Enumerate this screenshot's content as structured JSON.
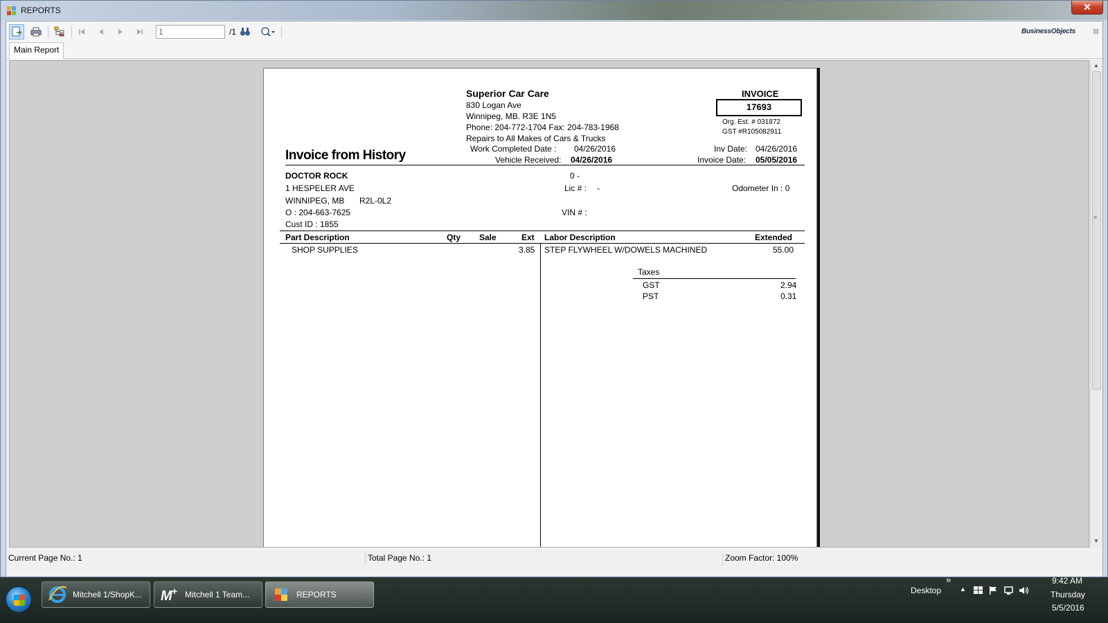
{
  "window": {
    "title": "REPORTS",
    "close_glyph": "✕"
  },
  "toolbar": {
    "page_value": "1",
    "page_total": "/1",
    "logo_main": "Business",
    "logo_accent": "Objects",
    "logo_close": "⊠"
  },
  "tabs": [
    {
      "label": "Main Report"
    }
  ],
  "report": {
    "company": {
      "name": "Superior Car Care",
      "address1": "830 Logan Ave",
      "address2": "Winnipeg, MB.  R3E 1N5",
      "phone": "Phone: 204-772-1704   Fax: 204-783-1968",
      "tagline": "Repairs to All Makes of Cars & Trucks"
    },
    "invoice_label": "INVOICE",
    "invoice_number": "17693",
    "org_est": "Org. Est. # 031872",
    "gst_reg": "GST #R105082911",
    "title": "Invoice from History",
    "work_completed_label": "Work Completed Date :",
    "work_completed_value": "04/26/2016",
    "vehicle_received_label": "Vehicle Received:",
    "vehicle_received_value": "04/26/2016",
    "inv_date_label": "Inv Date:",
    "inv_date_value": "04/26/2016",
    "invoice_date_label": "Invoice Date:",
    "invoice_date_value": "05/05/2016",
    "customer": {
      "name": "DOCTOR ROCK",
      "address1": "1 HESPELER AVE",
      "city": "WINNIPEG, MB",
      "postal": "R2L-0L2",
      "phone": "O :  204-663-7625",
      "cust_id": "Cust ID :  1855"
    },
    "vehicle": {
      "line1": "0  -",
      "lic_label": "Lic # :",
      "lic_value": "-",
      "vin_label": "VIN # :",
      "odometer": "Odometer In :  0"
    },
    "parts_headers": {
      "desc": "Part Description",
      "qty": "Qty",
      "sale": "Sale",
      "ext": "Ext"
    },
    "labor_headers": {
      "desc": "Labor Description",
      "ext": "Extended"
    },
    "parts": [
      {
        "desc": "SHOP SUPPLIES",
        "qty": "",
        "sale": "",
        "ext": "3.85"
      }
    ],
    "labor": [
      {
        "desc": "STEP FLYWHEEL W/DOWELS MACHINED",
        "ext": "55.00"
      }
    ],
    "taxes_label": "Taxes",
    "taxes": [
      {
        "name": "GST",
        "amount": "2.94"
      },
      {
        "name": "PST",
        "amount": "0.31"
      }
    ]
  },
  "status": {
    "current_page": "Current Page No.: 1",
    "total_page": "Total Page No.: 1",
    "zoom": "Zoom Factor: 100%"
  },
  "taskbar": {
    "items": [
      {
        "label": "Mitchell 1/ShopK..."
      },
      {
        "label": "Mitchell 1 Team..."
      },
      {
        "label": "REPORTS"
      }
    ],
    "desktop": "Desktop",
    "overflow": "»",
    "time": "9:42 AM",
    "day": "Thursday",
    "date": "5/5/2016"
  }
}
